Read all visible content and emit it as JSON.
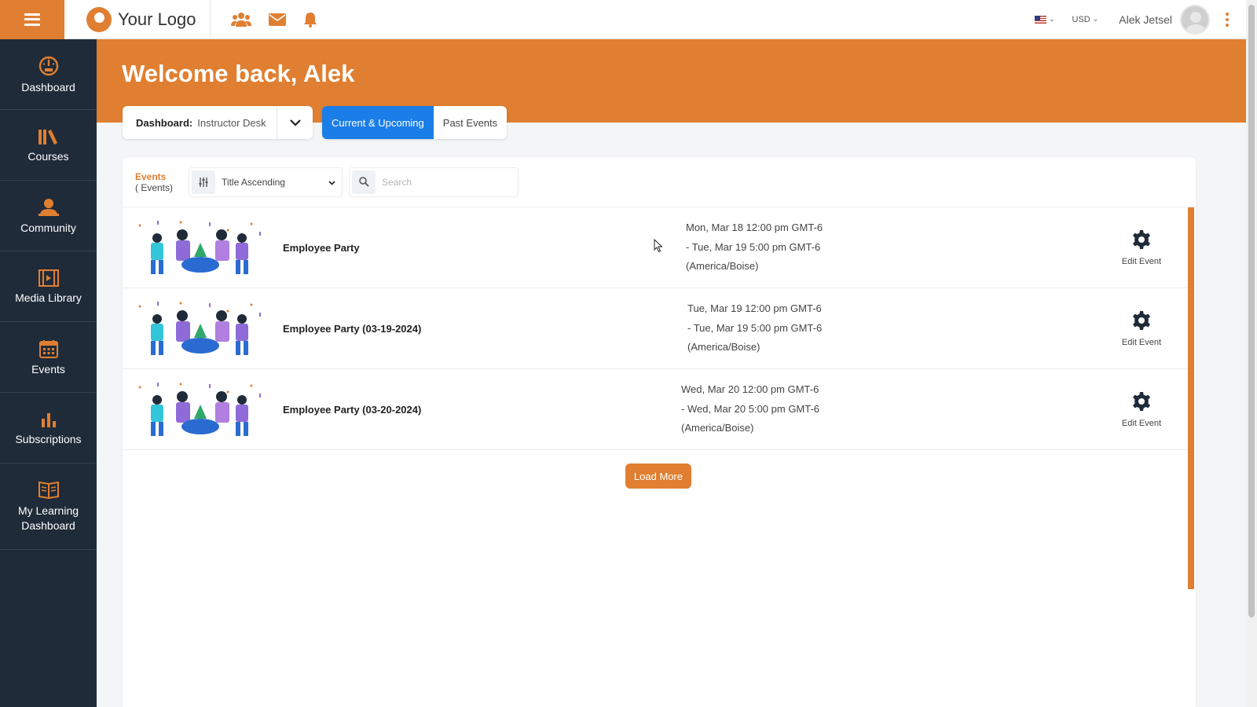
{
  "header": {
    "logo_text": "Your Logo",
    "icons": [
      "people-icon",
      "mail-icon",
      "bell-icon"
    ],
    "currency": "USD",
    "user_name": "Alek Jetsel",
    "accent_color": "#e07f31"
  },
  "sidebar": {
    "items": [
      {
        "label": "Dashboard",
        "icon": "dashboard-icon"
      },
      {
        "label": "Courses",
        "icon": "courses-icon"
      },
      {
        "label": "Community",
        "icon": "community-icon"
      },
      {
        "label": "Media Library",
        "icon": "media-library-icon"
      },
      {
        "label": "Events",
        "icon": "events-icon"
      },
      {
        "label": "Subscriptions",
        "icon": "subscriptions-icon"
      },
      {
        "label": "My Learning Dashboard",
        "icon": "my-learning-dashboard-icon"
      }
    ]
  },
  "main": {
    "welcome": "Welcome back, Alek",
    "dashboard_label": "Dashboard:",
    "dashboard_value": "Instructor Desk",
    "tabs": [
      {
        "label": "Current & Upcoming",
        "active": true
      },
      {
        "label": "Past Events",
        "active": false
      }
    ],
    "events_title": "Events",
    "events_subtitle": "( Events)",
    "sort_value": "Title Ascending",
    "search_placeholder": "Search",
    "events": [
      {
        "name": "Employee Party",
        "date_line1": "Mon, Mar 18 12:00 pm GMT-6",
        "date_line2": "- Tue, Mar 19 5:00 pm GMT-6",
        "date_line3": "(America/Boise)",
        "edit_label": "Edit Event"
      },
      {
        "name": "Employee Party (03-19-2024)",
        "date_line1": "Tue, Mar 19 12:00 pm GMT-6",
        "date_line2": "- Tue, Mar 19 5:00 pm GMT-6",
        "date_line3": "(America/Boise)",
        "edit_label": "Edit Event"
      },
      {
        "name": "Employee Party (03-20-2024)",
        "date_line1": "Wed, Mar 20 12:00 pm GMT-6",
        "date_line2": "- Wed, Mar 20 5:00 pm GMT-6",
        "date_line3": "(America/Boise)",
        "edit_label": "Edit Event"
      }
    ],
    "load_more_label": "Load More"
  }
}
